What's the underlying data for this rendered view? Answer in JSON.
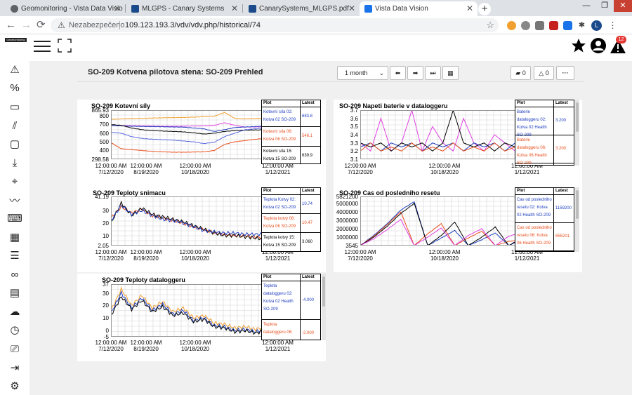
{
  "browser": {
    "tabs": [
      {
        "title": "Geomonitoring - Vista Data Visio",
        "favicon_color": "#5f6368"
      },
      {
        "title": "MLGPS - Canary Systems",
        "favicon_color": "#1a4a8a"
      },
      {
        "title": "CanarySystems_MLGPS.pdf",
        "favicon_color": "#1a4a8a"
      },
      {
        "title": "Vista Data Vision",
        "favicon_color": "#1a73e8"
      }
    ],
    "security_label": "Nezabezpečeno",
    "url": "109.123.193.3/vdv/vdv.php/historical/74",
    "profile_initial": "L"
  },
  "app": {
    "logo_text": "Geomonitoring",
    "notification_count": "12"
  },
  "page": {
    "title": "SO-209 Kotvena pilotova stena: SO-209 Prehled",
    "period_select": "1 month",
    "comments_count": "0",
    "alarms_count": "0",
    "more_label": "···"
  },
  "legend_headers": {
    "plot": "Plot",
    "latest": "Latest"
  },
  "chart_data": [
    {
      "type": "line",
      "title": "SO-209 Kotevní síly",
      "xlabel": "",
      "ylabel": "",
      "ylim": [
        298.58,
        865.93
      ],
      "yticks": [
        "865.93",
        "800",
        "700",
        "600",
        "500",
        "400",
        "298.58"
      ],
      "ytick_values": [
        865.93,
        800,
        700,
        600,
        500,
        400,
        298.58
      ],
      "xticks": [
        [
          "12:00:00 AM",
          "7/12/2020"
        ],
        [
          "12:00:00 AM",
          "8/19/2020"
        ],
        [
          "12:00:00 AM",
          "10/18/2020"
        ],
        [
          "12:00:00 AM",
          "1/12/2021"
        ]
      ],
      "grid": true,
      "legend_rows": [
        {
          "label": "Kotevní síla 02: Kotva 02 SO-209",
          "latest": "683.8",
          "color": "#1f3fbf"
        },
        {
          "label": "Kotevní síla 06: Kotva 06 SO-209",
          "latest": "546.1",
          "color": "#e8501e"
        },
        {
          "label": "Kotevní síla 15: Kotva 15 SO-209",
          "latest": "639.9",
          "color": "#000000"
        }
      ],
      "series": [
        {
          "color": "#f0a030",
          "values": [
            760,
            765,
            770,
            772,
            775,
            778,
            780,
            782,
            785,
            790,
            795,
            840,
            770,
            765,
            770,
            775,
            778,
            780
          ]
        },
        {
          "color": "#e040e0",
          "values": [
            690,
            688,
            686,
            684,
            682,
            680,
            680,
            681,
            683,
            685,
            690,
            720,
            690,
            670,
            672,
            675,
            676,
            678
          ]
        },
        {
          "color": "#1f3fbf",
          "values": [
            690,
            685,
            680,
            678,
            676,
            674,
            672,
            670,
            660,
            650,
            620,
            640,
            665,
            672,
            676,
            680,
            682,
            684
          ]
        },
        {
          "color": "#000000",
          "values": [
            700,
            690,
            660,
            640,
            630,
            625,
            620,
            615,
            605,
            590,
            600,
            620,
            630,
            635,
            637,
            638,
            639,
            640
          ]
        },
        {
          "color": "#5566dd",
          "values": [
            610,
            600,
            560,
            540,
            530,
            525,
            520,
            510,
            500,
            480,
            495,
            560,
            600,
            640,
            650,
            660,
            665,
            668
          ]
        },
        {
          "color": "#e8501e",
          "values": [
            490,
            420,
            410,
            400,
            390,
            385,
            380,
            380,
            382,
            385,
            400,
            470,
            500,
            515,
            530,
            540,
            544,
            546
          ]
        }
      ]
    },
    {
      "type": "line",
      "title": "SO-209 Napeti baterie v dataloggeru",
      "xlabel": "",
      "ylabel": "",
      "ylim": [
        3.1,
        3.7
      ],
      "yticks": [
        "3.7",
        "3.6",
        "3.5",
        "3.4",
        "3.3",
        "3.2",
        "3.1"
      ],
      "ytick_values": [
        3.7,
        3.6,
        3.5,
        3.4,
        3.3,
        3.2,
        3.1
      ],
      "xticks": [
        [
          "12:00:00 AM",
          "7/12/2020"
        ],
        [
          "12:00:00 AM",
          "10/18/2020"
        ],
        [
          "12:00:00 AM",
          "1/12/2021"
        ]
      ],
      "grid": true,
      "legend_rows": [
        {
          "label": "Baterie dataloggeru 02: Kotva 02 Health SO-209",
          "latest": "3.200",
          "color": "#1f3fbf"
        },
        {
          "label": "Baterie dataloggeru 06: Kotva 06 Health SO-209",
          "latest": "3.200",
          "color": "#e8501e"
        }
      ],
      "series": [
        {
          "color": "#e040e0",
          "values": [
            3.3,
            3.2,
            3.6,
            3.2,
            3.3,
            3.7,
            3.2,
            3.5,
            3.3,
            3.2,
            3.6,
            3.3,
            3.2,
            3.4,
            3.3,
            3.2,
            3.7,
            3.3
          ]
        },
        {
          "color": "#1f3fbf",
          "values": [
            3.25,
            3.3,
            3.2,
            3.3,
            3.25,
            3.3,
            3.2,
            3.3,
            3.25,
            3.3,
            3.2,
            3.3,
            3.25,
            3.3,
            3.2,
            3.3,
            3.25,
            3.3
          ]
        },
        {
          "color": "#000000",
          "values": [
            3.3,
            3.25,
            3.3,
            3.2,
            3.3,
            3.25,
            3.3,
            3.2,
            3.3,
            3.7,
            3.3,
            3.25,
            3.3,
            3.2,
            3.3,
            3.25,
            3.3,
            3.3
          ]
        },
        {
          "color": "#e8501e",
          "values": [
            3.2,
            3.3,
            3.2,
            3.25,
            3.2,
            3.3,
            3.2,
            3.25,
            3.2,
            3.3,
            3.2,
            3.25,
            3.2,
            3.3,
            3.2,
            3.25,
            3.2,
            3.15
          ]
        }
      ]
    },
    {
      "type": "line",
      "title": "SO-209 Teploty snimacu",
      "xlabel": "",
      "ylabel": "",
      "ylim": [
        2.05,
        41.19
      ],
      "yticks": [
        "41.19",
        "30",
        "20",
        "10",
        "2.05"
      ],
      "ytick_values": [
        41.19,
        30,
        20,
        10,
        2.05
      ],
      "xticks": [
        [
          "12:00:00 AM",
          "7/12/2020"
        ],
        [
          "12:00:00 AM",
          "8/19/2020"
        ],
        [
          "12:00:00 AM",
          "10/18/2020"
        ],
        [
          "12:00:00 AM",
          "1/12/2021"
        ]
      ],
      "grid": true,
      "legend_rows": [
        {
          "label": "Teplota Kotvy 02: Kotva 02 SO-209",
          "latest": "10.74",
          "color": "#1f3fbf"
        },
        {
          "label": "Teplota kotvy 06: Kotva 06 SO-209",
          "latest": "10.47",
          "color": "#e8501e"
        },
        {
          "label": "Teplota kotvy 15: Kotva 15 SO-209",
          "latest": "3.060",
          "color": "#000000"
        }
      ],
      "series": [
        {
          "color": "#e8501e",
          "values": [
            24,
            33,
            28,
            31,
            26,
            24,
            22,
            20,
            17,
            15,
            12,
            11,
            10,
            10,
            9,
            8,
            6,
            4
          ]
        },
        {
          "color": "#000000",
          "values": [
            20,
            36,
            26,
            32,
            27,
            25,
            23,
            21,
            18,
            15,
            12,
            10,
            10,
            9,
            8,
            7,
            5,
            3
          ]
        },
        {
          "color": "#1f3fbf",
          "values": [
            22,
            34,
            27,
            30,
            26,
            23,
            22,
            20,
            17,
            14,
            13,
            12,
            12,
            11,
            11,
            11,
            11,
            11
          ]
        }
      ]
    },
    {
      "type": "line",
      "title": "SO-209 Cas od posledniho resetu",
      "xlabel": "",
      "ylabel": "",
      "ylim": [
        3545,
        5821200
      ],
      "yticks": [
        "5821200",
        "5000000",
        "4000000",
        "3000000",
        "2000000",
        "1000000",
        "3545"
      ],
      "ytick_values": [
        5821200,
        5000000,
        4000000,
        3000000,
        2000000,
        1000000,
        3545
      ],
      "xticks": [
        [
          "12:00:00 AM",
          "7/12/2020"
        ],
        [
          "12:00:00 AM",
          "10/18/2020"
        ],
        [
          "12:00:00 AM",
          "1/12/2021"
        ]
      ],
      "grid": true,
      "legend_rows": [
        {
          "label": "Cas od posledniho resetu 02: Kotva 02 Health SO-209",
          "latest": "1159200",
          "color": "#1f3fbf"
        },
        {
          "label": "Cas od posledniho resetu 06: Kotva 06 Health SO-209",
          "latest": "655201",
          "color": "#e8501e"
        }
      ],
      "series": [
        {
          "color": "#1f3fbf",
          "values": [
            3545,
            1200000,
            2600000,
            4200000,
            5200000,
            3545,
            900000,
            1800000,
            3545,
            700000,
            1500000,
            3545,
            800000,
            1159200
          ]
        },
        {
          "color": "#e8501e",
          "values": [
            3545,
            1100000,
            2500000,
            4000000,
            3545,
            1400000,
            2600000,
            3545,
            900000,
            1700000,
            3545,
            500000,
            655201,
            655201
          ]
        },
        {
          "color": "#000000",
          "values": [
            3545,
            1000000,
            2300000,
            3800000,
            5000000,
            3545,
            1200000,
            2800000,
            3545,
            1000000,
            2200000,
            3545,
            900000,
            1300000
          ]
        },
        {
          "color": "#e040e0",
          "values": [
            3545,
            800000,
            1900000,
            3100000,
            3545,
            1000000,
            2100000,
            3545,
            1200000,
            2000000,
            3545,
            1100000,
            1600000,
            3545
          ]
        }
      ]
    },
    {
      "type": "line",
      "title": "SO-209 Teploty dataloggeru",
      "xlabel": "",
      "ylabel": "",
      "ylim": [
        -5,
        37
      ],
      "yticks": [
        "37",
        "30",
        "20",
        "10",
        "0",
        "-5"
      ],
      "ytick_values": [
        37,
        30,
        20,
        10,
        0,
        -5
      ],
      "xticks": [
        [
          "12:00:00 AM",
          "7/12/2020"
        ],
        [
          "12:00:00 AM",
          "8/19/2020"
        ],
        [
          "12:00:00 AM",
          "10/18/2020"
        ],
        [
          "12:00:00 AM",
          "1/12/2021"
        ]
      ],
      "grid": true,
      "legend_rows": [
        {
          "label": "Teplota dataloggeru 02: Kotva 02 Health SO-209",
          "latest": "-4.000",
          "color": "#1f3fbf"
        },
        {
          "label": "Teplota dataloggeru 06:",
          "latest": "-2.000",
          "color": "#e8501e"
        }
      ],
      "series": [
        {
          "color": "#f0a030",
          "values": [
            16,
            33,
            20,
            28,
            18,
            23,
            15,
            18,
            10,
            12,
            6,
            5,
            2,
            3,
            1,
            3,
            0,
            -2
          ]
        },
        {
          "color": "#1f3fbf",
          "values": [
            14,
            30,
            18,
            26,
            16,
            21,
            13,
            16,
            8,
            10,
            4,
            3,
            0,
            1,
            -1,
            1,
            -3,
            -4
          ]
        },
        {
          "color": "#000000",
          "values": [
            12,
            27,
            17,
            24,
            15,
            19,
            12,
            14,
            7,
            9,
            3,
            2,
            -1,
            0,
            -2,
            0,
            -3,
            -4
          ]
        }
      ]
    }
  ]
}
